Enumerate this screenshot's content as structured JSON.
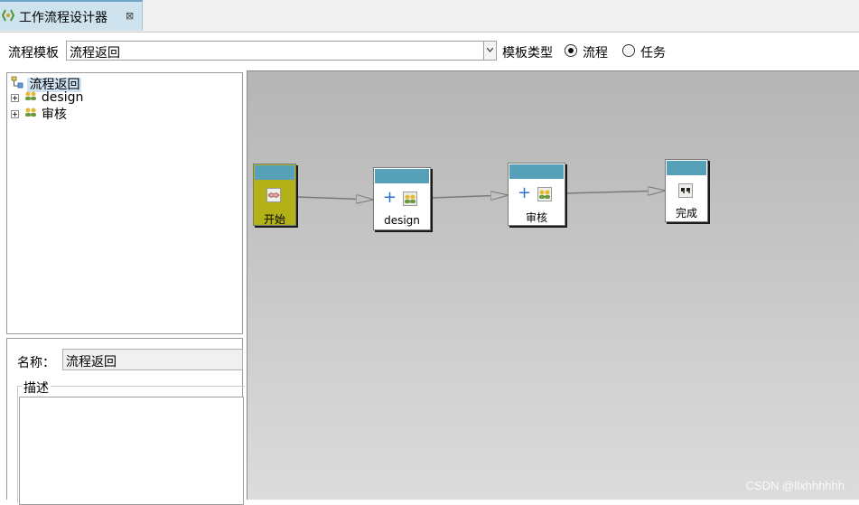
{
  "editor": {
    "tab_title": "工作流程设计器",
    "tab_close_icon": "close-tab-icon"
  },
  "toolbar": {
    "template_label": "流程模板",
    "template_value": "流程返回",
    "type_label": "模板类型",
    "radio_process": "流程",
    "radio_task": "任务",
    "selected_type": "流程"
  },
  "tree": {
    "root": "流程返回",
    "children": [
      "design",
      "审核"
    ]
  },
  "properties": {
    "name_label": "名称：",
    "name_value": "流程返回",
    "desc_label": "描述"
  },
  "diagram": {
    "header_color": "#56a0b8",
    "start_color": "#b2b218",
    "nodes": [
      {
        "label": "开始",
        "icon": "handshake-icon"
      },
      {
        "label": "design",
        "icon": "users-icon"
      },
      {
        "label": "审核",
        "icon": "users-icon"
      },
      {
        "label": "完成",
        "icon": "finish-flag-icon"
      }
    ]
  },
  "watermark": "CSDN @llxhhhhhh"
}
